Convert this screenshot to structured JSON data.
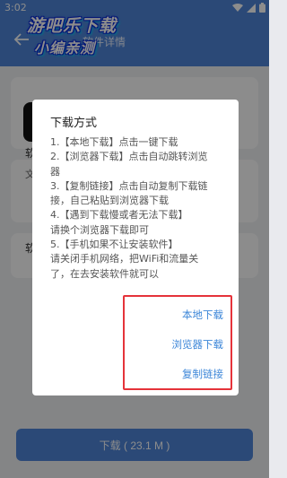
{
  "status": {
    "time": "3:02"
  },
  "app_bar": {
    "title": "软件详情"
  },
  "watermark": {
    "line1": "游吧乐下载",
    "line2": "小编亲测"
  },
  "background": {
    "label_a": "软",
    "label_b": "文",
    "label_c": "软"
  },
  "dialog": {
    "title": "下载方式",
    "lines": [
      "1.【本地下载】点击一键下载",
      "2.【浏览器下载】点击自动跳转浏览",
      "器",
      "3.【复制链接】点击自动复制下载链",
      "接，自己粘贴到浏览器下载",
      "4.【遇到下载慢或者无法下载】",
      "请换个浏览器下载即可",
      "5.【手机如果不让安装软件】",
      "请关闭手机网络，把WiFi和流量关",
      "了，在去安装软件就可以"
    ],
    "actions": {
      "local": "本地下载",
      "browser": "浏览器下载",
      "copy": "复制链接"
    }
  },
  "download_button": {
    "label": "下载 ( 23.1 M )"
  },
  "colors": {
    "primary": "#4f86d9",
    "link": "#3c86d8",
    "highlight": "#e5333a"
  }
}
